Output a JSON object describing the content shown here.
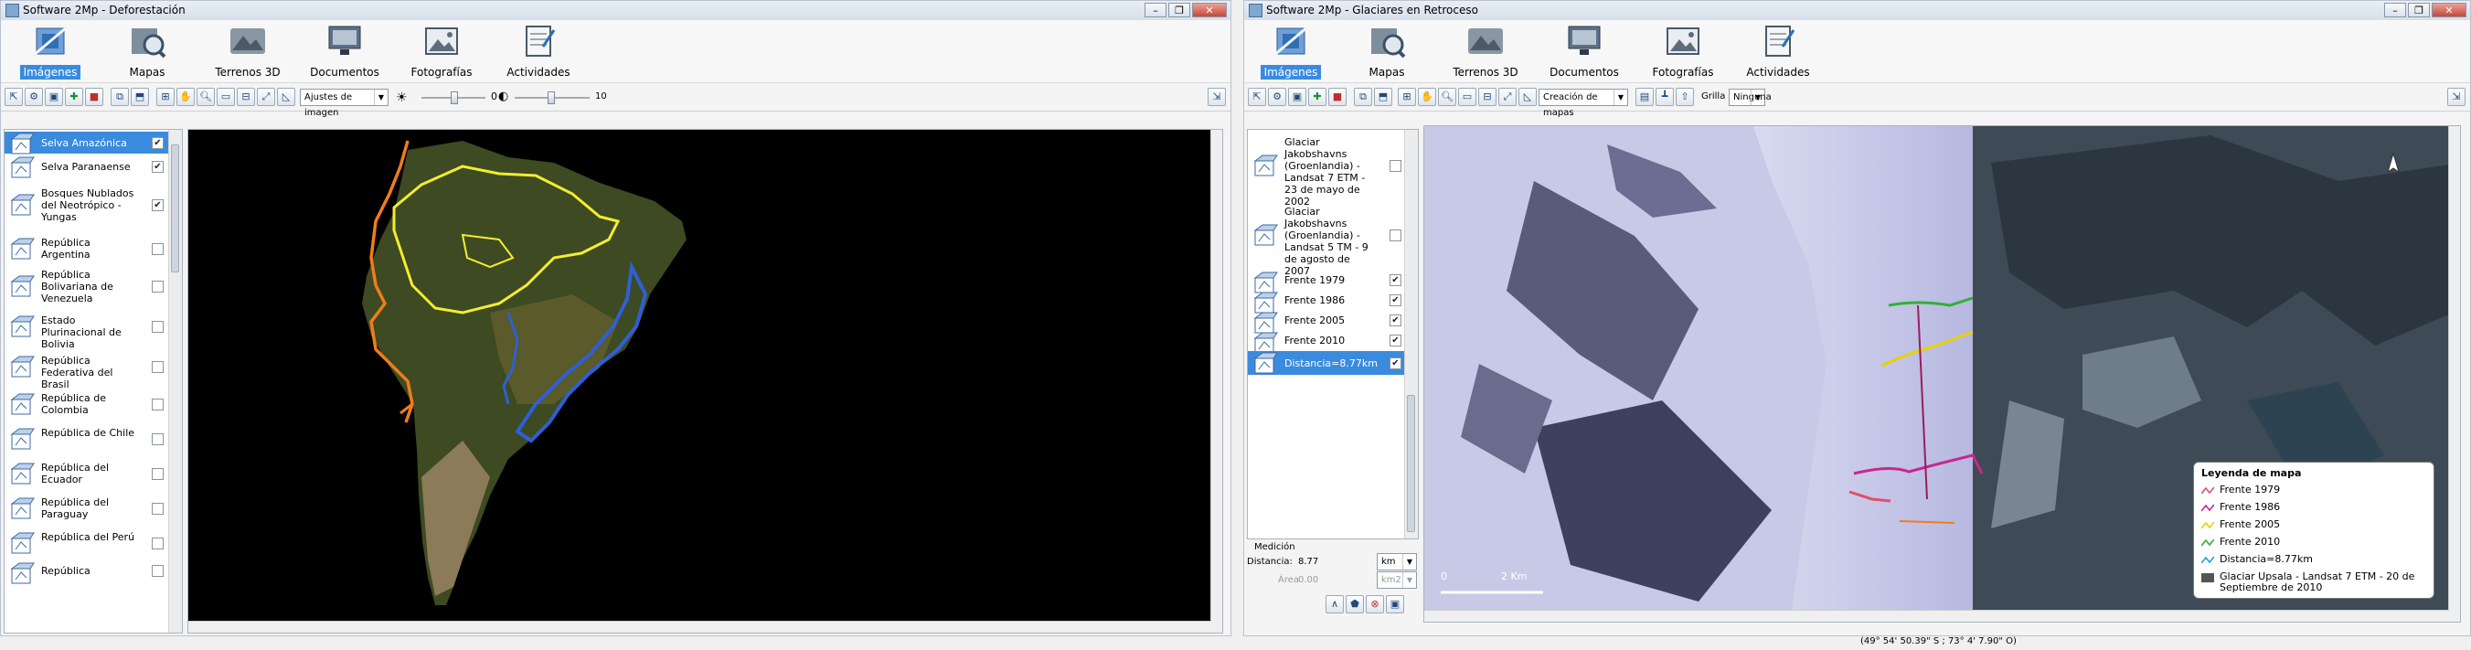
{
  "left_window": {
    "title": "Software 2Mp - Deforestación",
    "ribbon_tabs": [
      {
        "label": "Imágenes",
        "icon": "satellite-icon",
        "active": true
      },
      {
        "label": "Mapas",
        "icon": "map-search-icon",
        "active": false
      },
      {
        "label": "Terrenos 3D",
        "icon": "terrain-3d-icon",
        "active": false
      },
      {
        "label": "Documentos",
        "icon": "monitor-document-icon",
        "active": false
      },
      {
        "label": "Fotografías",
        "icon": "photo-icon",
        "active": false
      },
      {
        "label": "Actividades",
        "icon": "clipboard-activities-icon",
        "active": false
      }
    ],
    "toolbar": {
      "dropdown_value": "Ajustes de imagen",
      "slider_max_label": "10",
      "contrast_value": "0"
    },
    "layers": [
      {
        "label": "Selva Amazónica",
        "checked": true,
        "selected": true
      },
      {
        "label": "Selva Paranaense",
        "checked": true,
        "selected": false
      },
      {
        "label": "Bosques Nublados del Neotrópico - Yungas",
        "checked": true,
        "selected": false
      },
      {
        "label": "República Argentina",
        "checked": false,
        "selected": false
      },
      {
        "label": "República Bolivariana de Venezuela",
        "checked": false,
        "selected": false
      },
      {
        "label": "Estado Plurinacional de Bolivia",
        "checked": false,
        "selected": false
      },
      {
        "label": "República Federativa del Brasil",
        "checked": false,
        "selected": false
      },
      {
        "label": "República de Colombia",
        "checked": false,
        "selected": false
      },
      {
        "label": "República de Chile",
        "checked": false,
        "selected": false
      },
      {
        "label": "República del Ecuador",
        "checked": false,
        "selected": false
      },
      {
        "label": "República del Paraguay",
        "checked": false,
        "selected": false
      },
      {
        "label": "República del Perú",
        "checked": false,
        "selected": false
      },
      {
        "label": "República",
        "checked": false,
        "selected": false
      }
    ]
  },
  "right_window": {
    "title": "Software 2Mp - Glaciares en Retroceso",
    "ribbon_tabs": [
      {
        "label": "Imágenes",
        "icon": "satellite-icon",
        "active": true
      },
      {
        "label": "Mapas",
        "icon": "map-search-icon",
        "active": false
      },
      {
        "label": "Terrenos 3D",
        "icon": "terrain-3d-icon",
        "active": false
      },
      {
        "label": "Documentos",
        "icon": "monitor-document-icon",
        "active": false
      },
      {
        "label": "Fotografías",
        "icon": "photo-icon",
        "active": false
      },
      {
        "label": "Actividades",
        "icon": "clipboard-activities-icon",
        "active": false
      }
    ],
    "toolbar": {
      "dropdown_value": "Creación de mapas",
      "grid_label": "Grilla",
      "grid_value": "Ninguna"
    },
    "layers": [
      {
        "label": "Glaciar Jakobshavns (Groenlandia) - Landsat 7 ETM - 23 de mayo de 2002",
        "checked": false,
        "selected": false
      },
      {
        "label": "Glaciar Jakobshavns (Groenlandia) - Landsat 5 TM - 9 de agosto de 2007",
        "checked": false,
        "selected": false
      },
      {
        "label": "Frente 1979",
        "checked": true,
        "selected": false
      },
      {
        "label": "Frente 1986",
        "checked": true,
        "selected": false
      },
      {
        "label": "Frente 2005",
        "checked": true,
        "selected": false
      },
      {
        "label": "Frente 2010",
        "checked": true,
        "selected": false
      },
      {
        "label": "Distancia=8.77km",
        "checked": true,
        "selected": true
      }
    ],
    "measurement": {
      "section_label": "Medición",
      "distance_label": "Distancia:",
      "distance_value": "8.77",
      "distance_unit": "km",
      "area_label": "Área",
      "area_value": "0.00",
      "area_unit": "km2"
    },
    "legend": {
      "title": "Leyenda de mapa",
      "entries": [
        {
          "label": "Frente 1979",
          "color": "#e0506a"
        },
        {
          "label": "Frente 1986",
          "color": "#c8278f"
        },
        {
          "label": "Frente 2005",
          "color": "#e8d200"
        },
        {
          "label": "Frente 2010",
          "color": "#2fb12f"
        },
        {
          "label": "Distancia=8.77km",
          "color": "#1aa0d8"
        },
        {
          "label": "Glaciar Upsala - Landsat 7 ETM - 20 de Septiembre de 2010",
          "color": "#555555"
        }
      ]
    },
    "scale": {
      "start": "0",
      "end": "2 Km"
    },
    "status_coordinates": "(49° 54' 50.39\" S ; 73° 4' 7.90\" O)"
  },
  "colors": {
    "selection_blue": "#3a8bde",
    "amazon_outline": "#f2ee2c",
    "paranaense_outline": "#2f5fd6",
    "yungas_outline": "#ef7d1a"
  }
}
